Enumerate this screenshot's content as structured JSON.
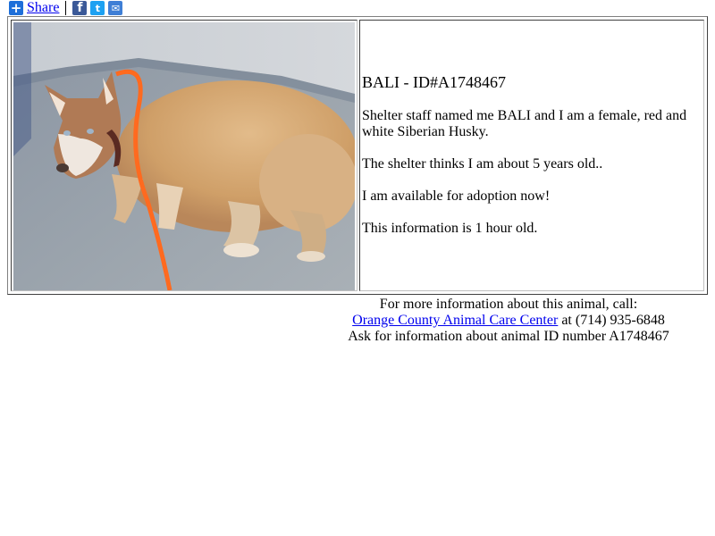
{
  "share": {
    "plus_icon": "plus-icon",
    "label": "Share",
    "social": [
      {
        "name": "facebook-icon",
        "glyph": "f",
        "color": "#3b5998"
      },
      {
        "name": "twitter-icon",
        "glyph": "t",
        "color": "#1da1f2"
      },
      {
        "name": "email-icon",
        "glyph": "✉",
        "color": "#3f7fd6"
      }
    ]
  },
  "animal": {
    "title": "BALI - ID#A1748467",
    "description": "Shelter staff named me BALI and I am a female, red and white Siberian Husky.",
    "age": "The shelter thinks I am about 5 years old..",
    "availability": "I am available for adoption now!",
    "freshness": "This information is 1 hour old."
  },
  "contact": {
    "intro": "For more information about this animal, call:",
    "shelter_name": "Orange County Animal Care Center",
    "at_phone": " at (714) 935-6848",
    "ask": "Ask for information about animal ID number A1748467"
  },
  "colors": {
    "link": "#0000ee",
    "leash": "#ff6a1f"
  }
}
